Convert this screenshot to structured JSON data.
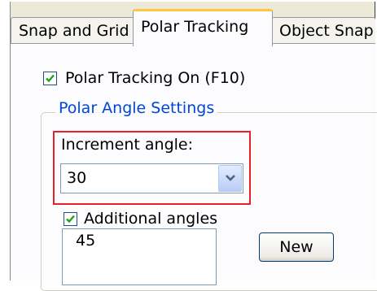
{
  "tabs": [
    {
      "label": "Snap and Grid",
      "active": false
    },
    {
      "label": "Polar Tracking",
      "active": true
    },
    {
      "label": "Object Snap",
      "active": false
    }
  ],
  "polar_tracking_on": {
    "label": "Polar Tracking On (F10)",
    "checked": true
  },
  "polar_angle_settings": {
    "title": "Polar Angle Settings",
    "increment_angle_label": "Increment angle:",
    "increment_angle_value": "30",
    "additional_angles": {
      "label": "Additional angles",
      "checked": true
    },
    "angles_list": [
      "45"
    ],
    "new_button_label": "New"
  },
  "colors": {
    "active_tab_accent": "#ffc83c",
    "group_title": "#0046d5",
    "highlight_border": "#e8202a"
  }
}
